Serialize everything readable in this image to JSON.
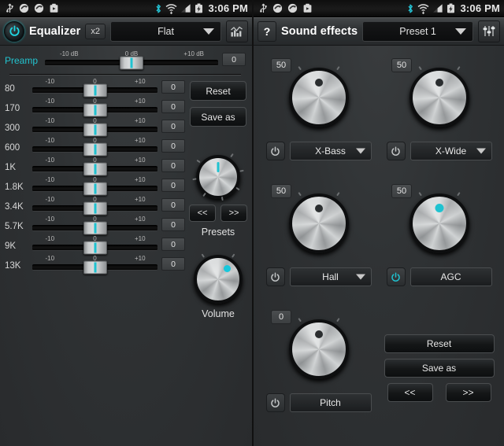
{
  "statusbar": {
    "icons": [
      "usb-icon",
      "sync-icon",
      "sync-icon",
      "screenshot-icon"
    ],
    "right_icons": [
      "bluetooth-icon",
      "wifi-icon",
      "signal-icon",
      "battery-charging-icon"
    ],
    "time": "3:06 PM",
    "bluetooth_color": "#24c6d8"
  },
  "left_panel": {
    "header": {
      "power_label": "power-toggle",
      "title": "Equalizer",
      "multiplier": "x2",
      "preset_value": "Flat",
      "graph_icon": "spectrum-icon",
      "accent": "#1fc2d0"
    },
    "preamp": {
      "label": "Preamp",
      "tick_min": "-10 dB",
      "tick_mid": "0 dB",
      "tick_max": "+10 dB",
      "value": "0",
      "thumb_pct": 50
    },
    "band_ticks": {
      "min": "-10",
      "mid": "0",
      "max": "+10"
    },
    "bands": [
      {
        "freq": "80",
        "value": "0",
        "thumb_pct": 50
      },
      {
        "freq": "170",
        "value": "0",
        "thumb_pct": 50
      },
      {
        "freq": "300",
        "value": "0",
        "thumb_pct": 50
      },
      {
        "freq": "600",
        "value": "0",
        "thumb_pct": 50
      },
      {
        "freq": "1K",
        "value": "0",
        "thumb_pct": 50
      },
      {
        "freq": "1.8K",
        "value": "0",
        "thumb_pct": 50
      },
      {
        "freq": "3.4K",
        "value": "0",
        "thumb_pct": 50
      },
      {
        "freq": "5.7K",
        "value": "0",
        "thumb_pct": 50
      },
      {
        "freq": "9K",
        "value": "0",
        "thumb_pct": 50
      },
      {
        "freq": "13K",
        "value": "0",
        "thumb_pct": 50
      }
    ],
    "reset_label": "Reset",
    "save_as_label": "Save as",
    "prev_label": "<<",
    "next_label": ">>",
    "presets_caption": "Presets",
    "volume_caption": "Volume"
  },
  "right_panel": {
    "header": {
      "help_label": "?",
      "title": "Sound effects",
      "preset_value": "Preset 1",
      "faders_icon": "faders-icon"
    },
    "effects": [
      {
        "name": "X-Bass",
        "value": "50",
        "enabled": false,
        "has_dropdown": true,
        "knob_angle": 0
      },
      {
        "name": "X-Wide",
        "value": "50",
        "enabled": false,
        "has_dropdown": true,
        "knob_angle": 0
      },
      {
        "name": "Hall",
        "value": "50",
        "enabled": false,
        "has_dropdown": true,
        "knob_angle": 0
      },
      {
        "name": "AGC",
        "value": "50",
        "enabled": true,
        "has_dropdown": false,
        "knob_angle": 0
      },
      {
        "name": "Pitch",
        "value": "0",
        "enabled": false,
        "has_dropdown": false,
        "knob_angle": 0
      }
    ],
    "reset_label": "Reset",
    "save_as_label": "Save as",
    "prev_label": "<<",
    "next_label": ">>",
    "accent": "#1fc2d0"
  }
}
